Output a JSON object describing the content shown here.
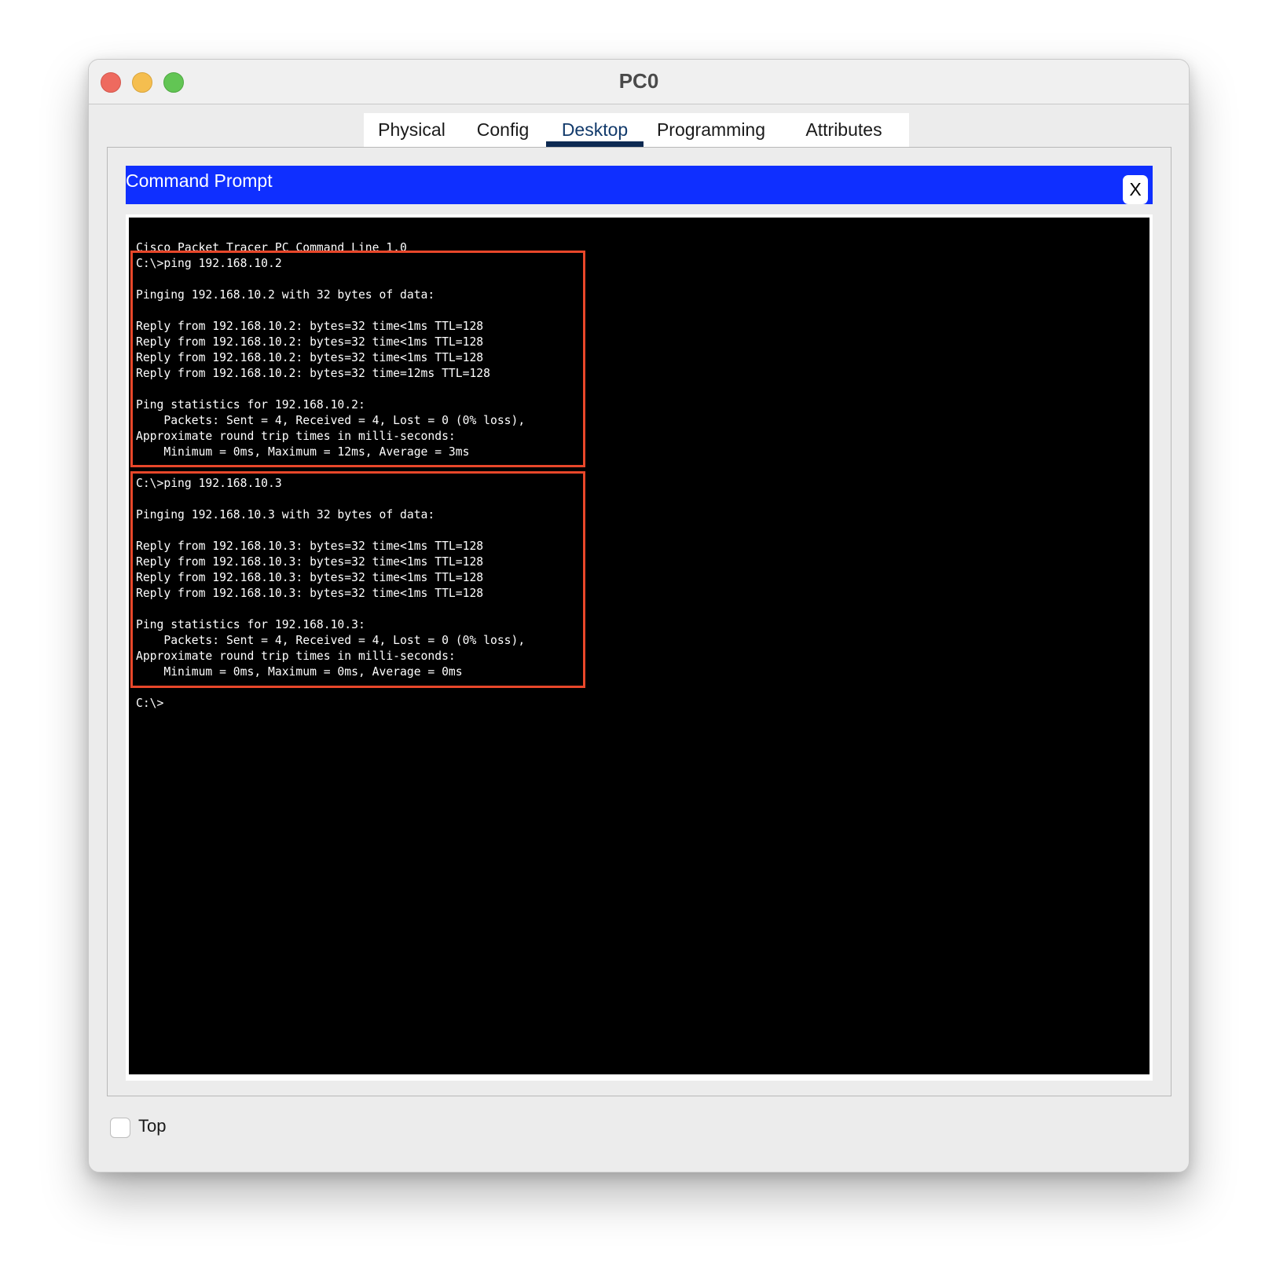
{
  "window": {
    "title": "PC0"
  },
  "tabs": [
    {
      "label": "Physical",
      "active": false
    },
    {
      "label": "Config",
      "active": false
    },
    {
      "label": "Desktop",
      "active": true
    },
    {
      "label": "Programming",
      "active": false
    },
    {
      "label": "Attributes",
      "active": false
    }
  ],
  "command_prompt": {
    "title": "Command Prompt",
    "close_label": "X",
    "lines": [
      "Cisco Packet Tracer PC Command Line 1.0",
      "C:\\>ping 192.168.10.2",
      "",
      "Pinging 192.168.10.2 with 32 bytes of data:",
      "",
      "Reply from 192.168.10.2: bytes=32 time<1ms TTL=128",
      "Reply from 192.168.10.2: bytes=32 time<1ms TTL=128",
      "Reply from 192.168.10.2: bytes=32 time<1ms TTL=128",
      "Reply from 192.168.10.2: bytes=32 time=12ms TTL=128",
      "",
      "Ping statistics for 192.168.10.2:",
      "    Packets: Sent = 4, Received = 4, Lost = 0 (0% loss),",
      "Approximate round trip times in milli-seconds:",
      "    Minimum = 0ms, Maximum = 12ms, Average = 3ms",
      "",
      "C:\\>ping 192.168.10.3",
      "",
      "Pinging 192.168.10.3 with 32 bytes of data:",
      "",
      "Reply from 192.168.10.3: bytes=32 time<1ms TTL=128",
      "Reply from 192.168.10.3: bytes=32 time<1ms TTL=128",
      "Reply from 192.168.10.3: bytes=32 time<1ms TTL=128",
      "Reply from 192.168.10.3: bytes=32 time<1ms TTL=128",
      "",
      "Ping statistics for 192.168.10.3:",
      "    Packets: Sent = 4, Received = 4, Lost = 0 (0% loss),",
      "Approximate round trip times in milli-seconds:",
      "    Minimum = 0ms, Maximum = 0ms, Average = 0ms",
      "",
      "C:\\>"
    ]
  },
  "footer": {
    "top_checkbox_label": "Top",
    "top_checked": false
  },
  "colors": {
    "header_blue": "#0f2fff",
    "highlight_border": "#e8472a",
    "active_tab_underline": "#0d2a52"
  }
}
